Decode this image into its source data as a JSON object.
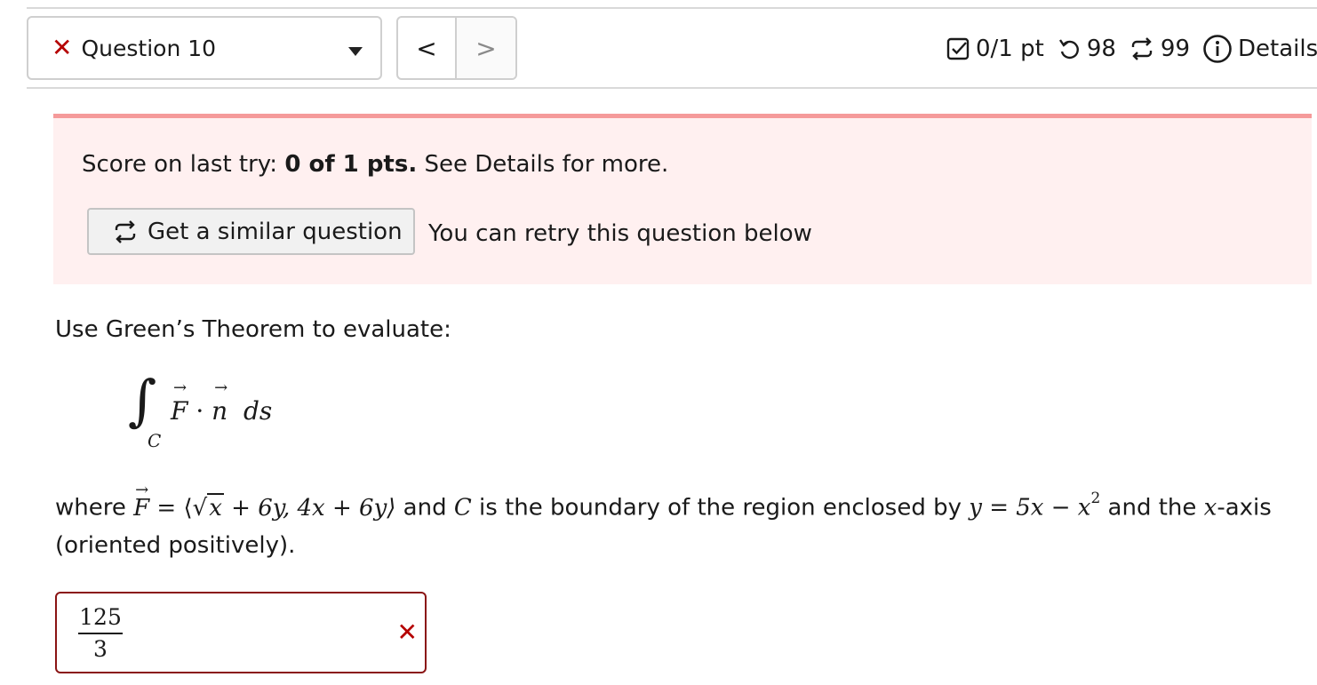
{
  "header": {
    "question_label": "Question 10",
    "prev_label": "<",
    "next_label": ">",
    "points": "0/1 pt",
    "retries_left": "98",
    "submissions": "99",
    "details": "Details"
  },
  "alert": {
    "score_prefix": "Score on last try: ",
    "score_value": "0 of 1 pts.",
    "score_suffix": " See Details for more.",
    "similar_button": "Get a similar question",
    "retry_text": "You can retry this question below"
  },
  "question": {
    "prompt": "Use Green’s Theorem to evaluate:",
    "integral_sub": "C",
    "integral_F": "F",
    "integral_dot": " · ",
    "integral_n": "n",
    "integral_ds": "  ds",
    "where_text": "where ",
    "field_F": "F",
    "field_def_a": " = ⟨",
    "field_sqrt_x": "x",
    "field_def_b": " + 6y, 4x + 6y⟩",
    "and_c_text": " and ",
    "curve_C": "C",
    "boundary_text": " is the boundary of the region enclosed by ",
    "curve_eq": "y = 5x − x",
    "curve_exp": "2",
    "and_the_text": " and the ",
    "axis_var": "x",
    "axis_text": "-axis (oriented positively)."
  },
  "answer": {
    "numerator": "125",
    "denominator": "3",
    "status": "incorrect",
    "status_color": "#b50000"
  },
  "colors": {
    "alert_bg": "#fff0f0",
    "alert_border": "#f59a9a",
    "error": "#b50000"
  }
}
